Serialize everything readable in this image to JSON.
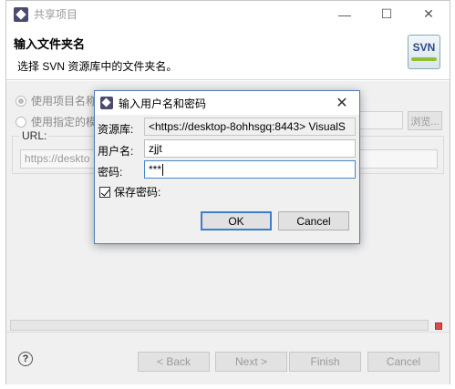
{
  "window": {
    "title": "共享项目",
    "minimize_glyph": "—",
    "maximize_glyph": "☐",
    "close_glyph": "✕"
  },
  "header": {
    "title": "输入文件夹名",
    "description": "选择 SVN 资源库中的文件夹名。",
    "logo_text": "SVN"
  },
  "options": {
    "use_project_name": "使用项目名称作",
    "use_specified_module": "使用指定的模块",
    "browse_label": "浏览..."
  },
  "url": {
    "label": "URL:",
    "value": "https://deskto"
  },
  "footer": {
    "help_glyph": "?",
    "back": "< Back",
    "next": "Next >",
    "finish": "Finish",
    "cancel": "Cancel"
  },
  "dialog": {
    "title": "输入用户名和密码",
    "repo_label": "资源库:",
    "repo_value": "<https://desktop-8ohhsgq:8443> VisualS",
    "user_label": "用户名:",
    "user_value": "zjjt",
    "pass_label": "密码:",
    "pass_value": "***",
    "save_password_label": "保存密码:",
    "save_password_checked": true,
    "ok": "OK",
    "cancel": "Cancel"
  },
  "colors": {
    "dialog_border": "#4f7db6",
    "focus_border": "#4b86c4",
    "stop_red": "#d94c4c"
  }
}
